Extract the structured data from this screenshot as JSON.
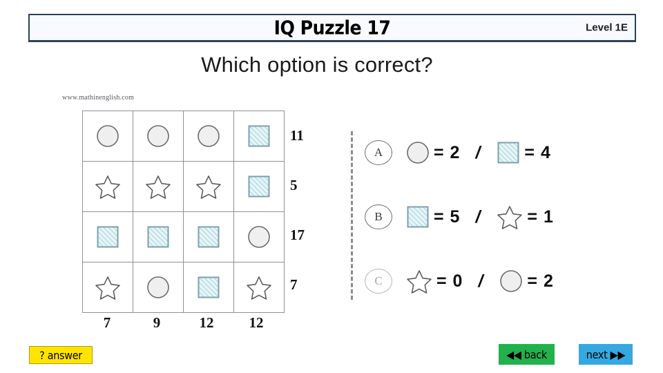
{
  "header": {
    "title": "IQ Puzzle 17",
    "level": "Level 1E",
    "subtitle": "Which option is correct?"
  },
  "puzzle": {
    "watermark": "www.mathinenglish.com",
    "grid": [
      [
        "circle",
        "circle",
        "circle",
        "square"
      ],
      [
        "star",
        "star",
        "star",
        "square"
      ],
      [
        "square",
        "square",
        "square",
        "circle"
      ],
      [
        "star",
        "circle",
        "square",
        "star"
      ]
    ],
    "row_sums": [
      "11",
      "5",
      "17",
      "7"
    ],
    "col_sums": [
      "7",
      "9",
      "12",
      "12"
    ]
  },
  "options": [
    {
      "label": "A",
      "dim": false,
      "left_shape": "circle",
      "left_value": "= 2",
      "separator": "/",
      "right_shape": "square",
      "right_value": "= 4"
    },
    {
      "label": "B",
      "dim": false,
      "left_shape": "square",
      "left_value": "= 5",
      "separator": "/",
      "right_shape": "star",
      "right_value": "= 1"
    },
    {
      "label": "C",
      "dim": true,
      "left_shape": "star",
      "left_value": "= 0",
      "separator": "/",
      "right_shape": "circle",
      "right_value": "= 2"
    }
  ],
  "footer": {
    "answer_label": "? answer",
    "back_label": "◀◀ back",
    "next_label": "next ▶▶"
  },
  "colors": {
    "title_border": "#2c4058",
    "title_fill": "#f7faff",
    "square_fill": "#e4f5f8",
    "square_stroke": "#7da0ad",
    "circle_fill": "#efefef",
    "circle_stroke": "#6b6b6b",
    "star_stroke": "#5d5d5d",
    "grid_line": "#8d9095",
    "answer_bg": "#ffe400",
    "back_bg": "#22b14c",
    "next_bg": "#35a8e0"
  }
}
